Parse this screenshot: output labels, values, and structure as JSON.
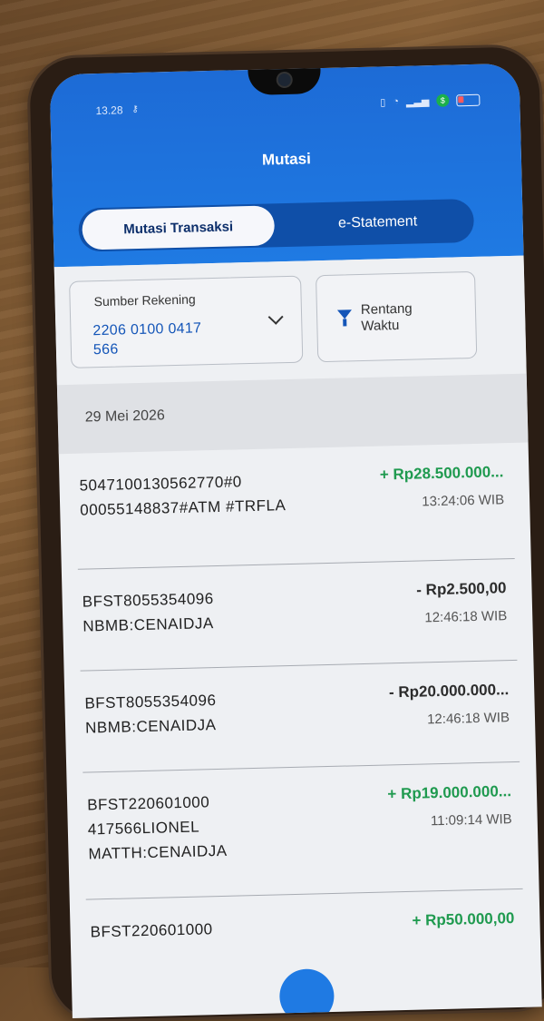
{
  "status_bar": {
    "time": "13.28",
    "key_glyph": "⚷"
  },
  "header": {
    "title": "Mutasi"
  },
  "tabs": [
    {
      "label": "Mutasi Transaksi",
      "active": true
    },
    {
      "label": "e-Statement",
      "active": false
    }
  ],
  "filters": {
    "source_label": "Sumber Rekening",
    "source_value": "2206 0100 0417 566",
    "range_label": "Rentang Waktu"
  },
  "date_header": "29 Mei 2026",
  "transactions": [
    {
      "description": "5047100130562770#0 00055148837#ATM #TRFLA",
      "amount": "+ Rp28.500.000...",
      "time": "13:24:06 WIB",
      "type": "credit"
    },
    {
      "description": "BFST8055354096 NBMB:CENAIDJA",
      "amount": "- Rp2.500,00",
      "time": "12:46:18 WIB",
      "type": "debit"
    },
    {
      "description": "BFST8055354096 NBMB:CENAIDJA",
      "amount": "- Rp20.000.000...",
      "time": "12:46:18 WIB",
      "type": "debit"
    },
    {
      "description": "BFST220601000 417566LIONEL MATTH:CENAIDJA",
      "amount": "+ Rp19.000.000...",
      "time": "11:09:14 WIB",
      "type": "credit"
    },
    {
      "description": "BFST220601000",
      "amount": "+ Rp50.000,00",
      "time": "",
      "type": "credit"
    }
  ],
  "colors": {
    "header_blue": "#1f7ae3",
    "credit_green": "#1f9a4f",
    "account_blue": "#1455b8"
  }
}
